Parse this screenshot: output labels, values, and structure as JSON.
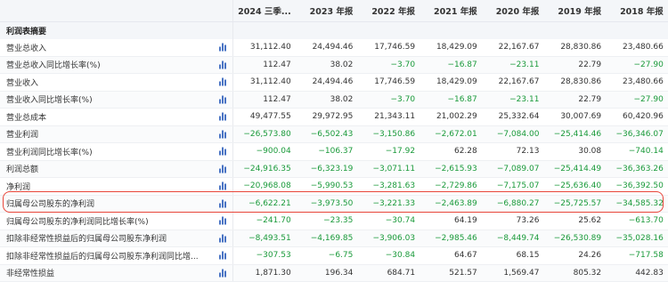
{
  "header": {
    "columns": [
      "2024 三季...",
      "2023 年报",
      "2022 年报",
      "2021 年报",
      "2020 年报",
      "2019 年报",
      "2018 年报"
    ]
  },
  "section": {
    "title": "利润表摘要"
  },
  "rows": [
    {
      "label": "营业总收入",
      "values": [
        "31,112.40",
        "24,494.46",
        "17,746.59",
        "18,429.09",
        "22,167.67",
        "28,830.86",
        "23,480.66"
      ],
      "neg": [
        false,
        false,
        false,
        false,
        false,
        false,
        false
      ]
    },
    {
      "label": "营业总收入同比增长率(%)",
      "values": [
        "112.47",
        "38.02",
        "−3.70",
        "−16.87",
        "−23.11",
        "22.79",
        "−27.90"
      ],
      "neg": [
        false,
        false,
        true,
        true,
        true,
        false,
        true
      ]
    },
    {
      "label": "营业收入",
      "values": [
        "31,112.40",
        "24,494.46",
        "17,746.59",
        "18,429.09",
        "22,167.67",
        "28,830.86",
        "23,480.66"
      ],
      "neg": [
        false,
        false,
        false,
        false,
        false,
        false,
        false
      ]
    },
    {
      "label": "营业收入同比增长率(%)",
      "values": [
        "112.47",
        "38.02",
        "−3.70",
        "−16.87",
        "−23.11",
        "22.79",
        "−27.90"
      ],
      "neg": [
        false,
        false,
        true,
        true,
        true,
        false,
        true
      ]
    },
    {
      "label": "营业总成本",
      "values": [
        "49,477.55",
        "29,972.95",
        "21,343.11",
        "21,002.29",
        "25,332.64",
        "30,007.69",
        "60,420.96"
      ],
      "neg": [
        false,
        false,
        false,
        false,
        false,
        false,
        false
      ]
    },
    {
      "label": "营业利润",
      "values": [
        "−26,573.80",
        "−6,502.43",
        "−3,150.86",
        "−2,672.01",
        "−7,084.00",
        "−25,414.46",
        "−36,346.07"
      ],
      "neg": [
        true,
        true,
        true,
        true,
        true,
        true,
        true
      ]
    },
    {
      "label": "营业利润同比增长率(%)",
      "values": [
        "−900.04",
        "−106.37",
        "−17.92",
        "62.28",
        "72.13",
        "30.08",
        "−740.14"
      ],
      "neg": [
        true,
        true,
        true,
        false,
        false,
        false,
        true
      ]
    },
    {
      "label": "利润总额",
      "values": [
        "−24,916.35",
        "−6,323.19",
        "−3,071.11",
        "−2,615.93",
        "−7,089.07",
        "−25,414.49",
        "−36,363.26"
      ],
      "neg": [
        true,
        true,
        true,
        true,
        true,
        true,
        true
      ]
    },
    {
      "label": "净利润",
      "values": [
        "−20,968.08",
        "−5,990.53",
        "−3,281.63",
        "−2,729.86",
        "−7,175.07",
        "−25,636.40",
        "−36,392.50"
      ],
      "neg": [
        true,
        true,
        true,
        true,
        true,
        true,
        true
      ]
    },
    {
      "label": "归属母公司股东的净利润",
      "values": [
        "−6,622.21",
        "−3,973.50",
        "−3,221.33",
        "−2,463.89",
        "−6,880.27",
        "−25,725.57",
        "−34,585.32"
      ],
      "neg": [
        true,
        true,
        true,
        true,
        true,
        true,
        true
      ]
    },
    {
      "label": "归属母公司股东的净利润同比增长率(%)",
      "values": [
        "−241.70",
        "−23.35",
        "−30.74",
        "64.19",
        "73.26",
        "25.62",
        "−613.70"
      ],
      "neg": [
        true,
        true,
        true,
        false,
        false,
        false,
        true
      ]
    },
    {
      "label": "扣除非经常性损益后的归属母公司股东净利润",
      "values": [
        "−8,493.51",
        "−4,169.85",
        "−3,906.03",
        "−2,985.46",
        "−8,449.74",
        "−26,530.89",
        "−35,028.16"
      ],
      "neg": [
        true,
        true,
        true,
        true,
        true,
        true,
        true
      ]
    },
    {
      "label": "扣除非经常性损益后的归属母公司股东净利润同比增...",
      "values": [
        "−307.53",
        "−6.75",
        "−30.84",
        "64.67",
        "68.15",
        "24.26",
        "−717.58"
      ],
      "neg": [
        true,
        true,
        true,
        false,
        false,
        false,
        true
      ]
    },
    {
      "label": "非经常性损益",
      "values": [
        "1,871.30",
        "196.34",
        "684.71",
        "521.57",
        "1,569.47",
        "805.32",
        "442.83"
      ],
      "neg": [
        false,
        false,
        false,
        false,
        false,
        false,
        false
      ]
    }
  ],
  "colors": {
    "negative": "#1a9a3a",
    "highlight_border": "#e8463a",
    "chart_icon": "#4a74c4"
  },
  "icon": "bar-chart-icon"
}
